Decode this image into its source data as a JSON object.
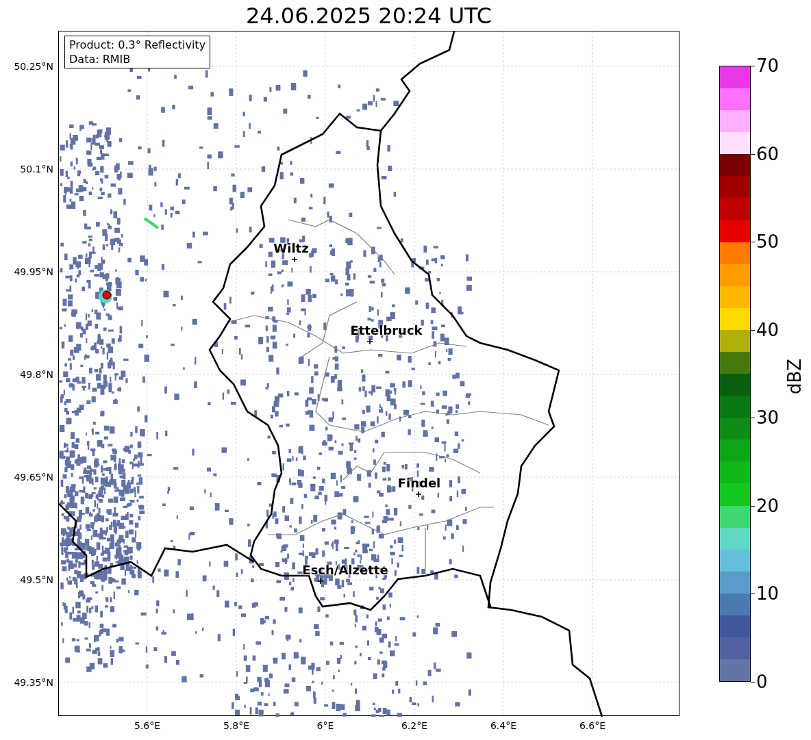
{
  "title": "24.06.2025 20:24 UTC",
  "info_box": {
    "lines": [
      "Product: 0.3° Reflectivity",
      "Data: RMIB"
    ]
  },
  "map": {
    "lat_ticks": [
      "50.25°N",
      "50.1°N",
      "49.95°N",
      "49.8°N",
      "49.65°N",
      "49.5°N",
      "49.35°N"
    ],
    "lon_ticks": [
      "5.6°E",
      "5.8°E",
      "6°E",
      "6.2°E",
      "6.4°E",
      "6.6°E"
    ],
    "cities": [
      {
        "name": "Wiltz"
      },
      {
        "name": "Ettelbruck"
      },
      {
        "name": "Findel"
      },
      {
        "name": "Esch/Alzette"
      }
    ]
  },
  "colorbar": {
    "label": "dBZ",
    "ticks": [
      "70",
      "60",
      "50",
      "40",
      "30",
      "20",
      "10",
      "0"
    ],
    "bins": [
      {
        "color": "#e838e8"
      },
      {
        "color": "#ff70ff"
      },
      {
        "color": "#ffb0ff"
      },
      {
        "color": "#ffe0ff"
      },
      {
        "color": "#780000"
      },
      {
        "color": "#a00000"
      },
      {
        "color": "#c00000"
      },
      {
        "color": "#e60000"
      },
      {
        "color": "#ff7c00"
      },
      {
        "color": "#ff9c00"
      },
      {
        "color": "#ffb800"
      },
      {
        "color": "#ffd800"
      },
      {
        "color": "#b0b00a"
      },
      {
        "color": "#467a0e"
      },
      {
        "color": "#08600e"
      },
      {
        "color": "#0a7812"
      },
      {
        "color": "#0e8c16"
      },
      {
        "color": "#10a418"
      },
      {
        "color": "#10b81a"
      },
      {
        "color": "#12c820"
      },
      {
        "color": "#40d672"
      },
      {
        "color": "#60d6c4"
      },
      {
        "color": "#64bedc"
      },
      {
        "color": "#5a9cc8"
      },
      {
        "color": "#4a7ab0"
      },
      {
        "color": "#42589e"
      },
      {
        "color": "#52629f"
      },
      {
        "color": "#6474a6"
      }
    ]
  }
}
